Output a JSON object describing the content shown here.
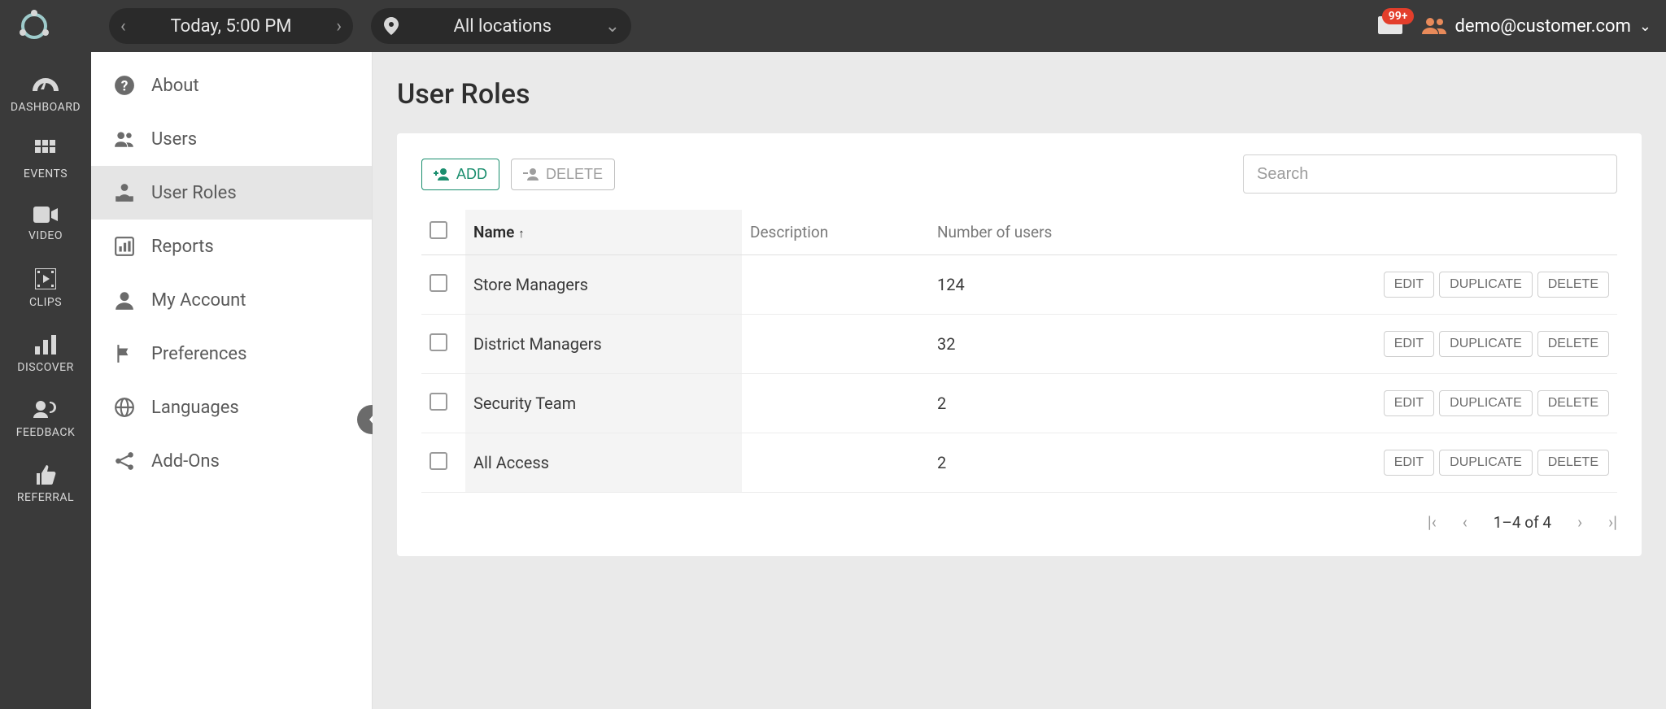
{
  "header": {
    "date_label": "Today, 5:00 PM",
    "location_label": "All locations",
    "inbox_badge": "99+",
    "user_email": "demo@customer.com"
  },
  "leftnav": {
    "items": [
      {
        "label": "DASHBOARD",
        "icon": "gauge-icon"
      },
      {
        "label": "EVENTS",
        "icon": "grid-icon"
      },
      {
        "label": "VIDEO",
        "icon": "video-icon"
      },
      {
        "label": "CLIPS",
        "icon": "film-icon"
      },
      {
        "label": "DISCOVER",
        "icon": "bars-icon"
      },
      {
        "label": "FEEDBACK",
        "icon": "feedback-icon"
      },
      {
        "label": "REFERRAL",
        "icon": "thumb-icon"
      }
    ]
  },
  "sidebar": {
    "items": [
      {
        "label": "About",
        "icon": "help-icon"
      },
      {
        "label": "Users",
        "icon": "people-icon"
      },
      {
        "label": "User Roles",
        "icon": "userrole-icon",
        "active": true
      },
      {
        "label": "Reports",
        "icon": "chart-icon"
      },
      {
        "label": "My Account",
        "icon": "person-icon"
      },
      {
        "label": "Preferences",
        "icon": "flag-icon"
      },
      {
        "label": "Languages",
        "icon": "globe-icon"
      },
      {
        "label": "Add-Ons",
        "icon": "share-icon"
      }
    ]
  },
  "page": {
    "title": "User Roles",
    "add_label": "ADD",
    "delete_label": "DELETE",
    "search_placeholder": "Search",
    "columns": {
      "name": "Name",
      "desc": "Description",
      "count": "Number of users"
    },
    "row_actions": {
      "edit": "EDIT",
      "duplicate": "DUPLICATE",
      "delete": "DELETE"
    },
    "rows": [
      {
        "name": "Store Managers",
        "desc": "",
        "count": "124"
      },
      {
        "name": "District Managers",
        "desc": "",
        "count": "32"
      },
      {
        "name": "Security Team",
        "desc": "",
        "count": "2"
      },
      {
        "name": "All Access",
        "desc": "",
        "count": "2"
      }
    ],
    "pager": "1–4 of 4"
  }
}
